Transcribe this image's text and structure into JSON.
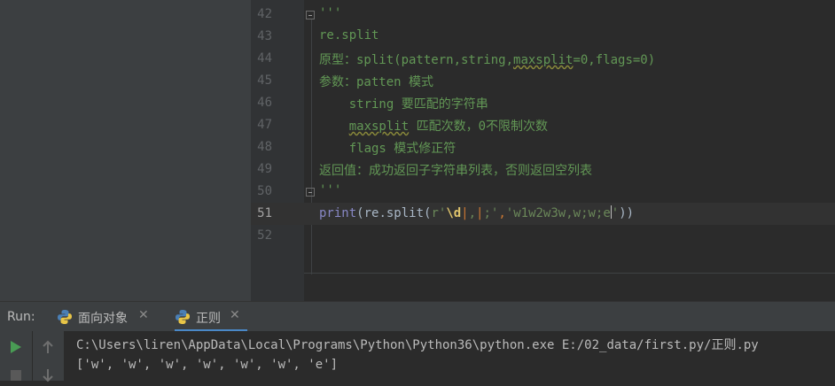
{
  "editor": {
    "lines": [
      {
        "num": "42",
        "text": "'''"
      },
      {
        "num": "43",
        "text": "re.split"
      },
      {
        "num": "44",
        "pre": "原型：split(pattern,string,",
        "warn": "maxsplit",
        "post": "=0,flags=0)"
      },
      {
        "num": "45",
        "text": "参数：patten 模式"
      },
      {
        "num": "46",
        "text": "    string 要匹配的字符串"
      },
      {
        "num": "47",
        "pre": "    ",
        "warn": "maxsplit",
        "post": " 匹配次数，0不限制次数"
      },
      {
        "num": "48",
        "text": "    flags 模式修正符"
      },
      {
        "num": "49",
        "text": "返回值：成功返回子字符串列表，否则返回空列表"
      },
      {
        "num": "50",
        "text": "'''"
      },
      {
        "num": "51",
        "fn": "print",
        "p1": "(re.split(",
        "r": "r'",
        "esc": "\\d",
        "pipe1": "|",
        "comma": ",",
        "pipe2": "|",
        "semi": ";'",
        "sep": ",",
        "arg": "'w1w2w3w,w;w;e",
        "q": "'",
        "close": "))"
      },
      {
        "num": "52",
        "text": ""
      }
    ]
  },
  "run_panel": {
    "label": "Run:",
    "tabs": [
      {
        "label": "面向对象",
        "close": "✕"
      },
      {
        "label": "正则",
        "close": "✕"
      }
    ]
  },
  "console": {
    "lines": [
      "C:\\Users\\liren\\AppData\\Local\\Programs\\Python\\Python36\\python.exe E:/02_data/first.py/正则.py",
      "['w', 'w', 'w', 'w', 'w', 'w', 'e']"
    ]
  },
  "colors": {
    "docstring": "#629755",
    "builtin": "#8888c6",
    "string": "#6a8759",
    "run_icon": "#499c54"
  },
  "icons": [
    "fold-icon",
    "python-icon",
    "close-icon",
    "run-icon",
    "stop-icon",
    "up-arrow-icon",
    "down-arrow-icon"
  ]
}
